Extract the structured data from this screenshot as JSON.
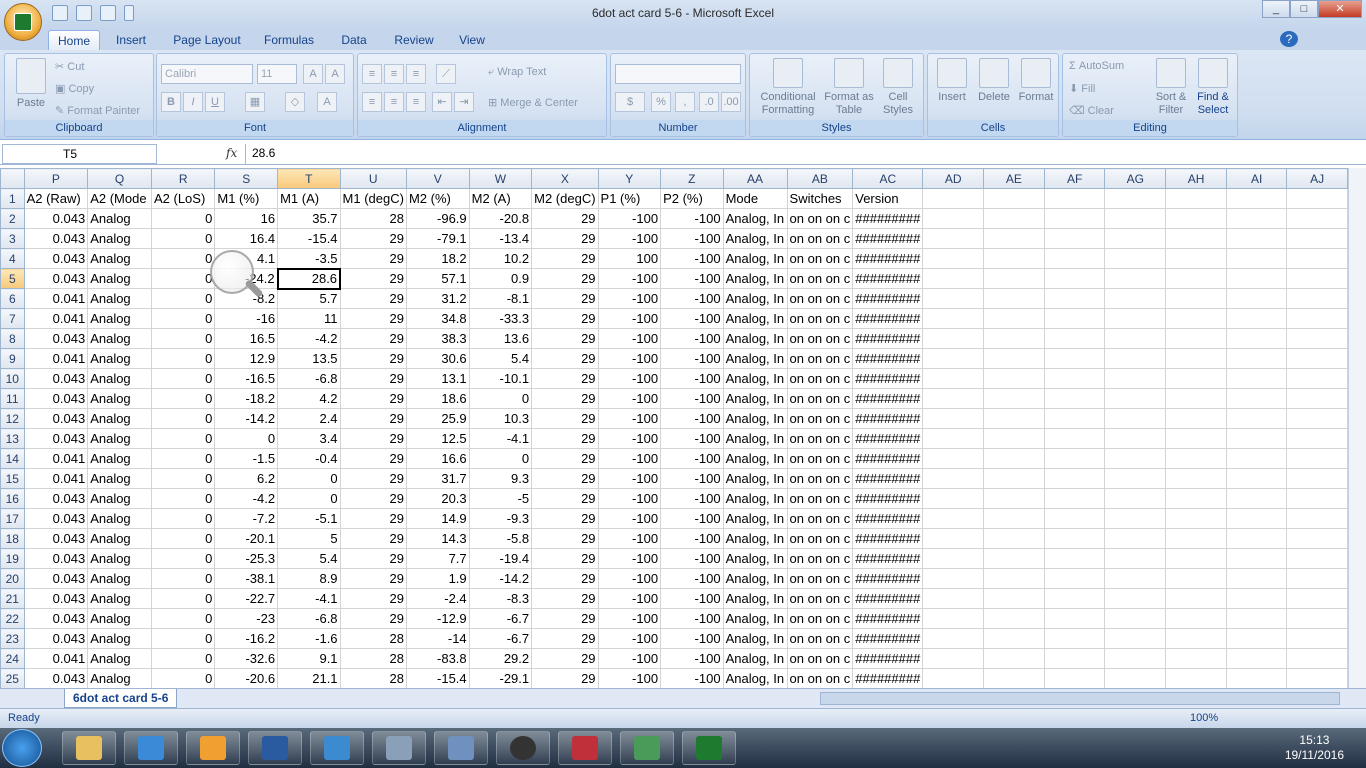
{
  "window": {
    "title": "6dot act card 5-6  -  Microsoft Excel",
    "help": "?"
  },
  "tabs": [
    "Home",
    "Insert",
    "Page Layout",
    "Formulas",
    "Data",
    "Review",
    "View"
  ],
  "ribbon": {
    "clipboard": {
      "label": "Clipboard",
      "paste": "Paste",
      "cut": "Cut",
      "copy": "Copy",
      "format_painter": "Format Painter"
    },
    "font": {
      "label": "Font",
      "name": "Calibri",
      "size": "11"
    },
    "alignment": {
      "label": "Alignment",
      "wrap": "Wrap Text",
      "merge": "Merge & Center"
    },
    "number": {
      "label": "Number"
    },
    "styles": {
      "label": "Styles",
      "cond": "Conditional Formatting",
      "table": "Format as Table",
      "cell": "Cell Styles"
    },
    "cells": {
      "label": "Cells",
      "insert": "Insert",
      "delete": "Delete",
      "format": "Format"
    },
    "editing": {
      "label": "Editing",
      "autosum": "AutoSum",
      "fill": "Fill",
      "clear": "Clear",
      "sort": "Sort & Filter",
      "find": "Find & Select"
    }
  },
  "formula_bar": {
    "name_box": "T5",
    "fx": "fx",
    "content": "28.6"
  },
  "columns": [
    "P",
    "Q",
    "R",
    "S",
    "T",
    "U",
    "V",
    "W",
    "X",
    "Y",
    "Z",
    "AA",
    "AB",
    "AC",
    "AD",
    "AE",
    "AF",
    "AG",
    "AH",
    "AI",
    "AJ"
  ],
  "selected_column": "T",
  "selected_row": 5,
  "header_row": [
    "A2 (Raw)",
    "A2 (Mode",
    "A2 (LoS)",
    "M1 (%)",
    "M1 (A)",
    "M1 (degC)",
    "M2 (%)",
    "M2 (A)",
    "M2 (degC)",
    "P1 (%)",
    "P2 (%)",
    "Mode",
    "Switches",
    "Version"
  ],
  "rows": [
    [
      "0.043",
      "Analog",
      "0",
      "16",
      "35.7",
      "28",
      "-96.9",
      "-20.8",
      "29",
      "-100",
      "-100",
      "Analog, In",
      "on on on c",
      "#########"
    ],
    [
      "0.043",
      "Analog",
      "0",
      "16.4",
      "-15.4",
      "29",
      "-79.1",
      "-13.4",
      "29",
      "-100",
      "-100",
      "Analog, In",
      "on on on c",
      "#########"
    ],
    [
      "0.043",
      "Analog",
      "0",
      "4.1",
      "-3.5",
      "29",
      "18.2",
      "10.2",
      "29",
      "100",
      "-100",
      "Analog, In",
      "on on on c",
      "#########"
    ],
    [
      "0.043",
      "Analog",
      "0",
      "-24.2",
      "28.6",
      "29",
      "57.1",
      "0.9",
      "29",
      "-100",
      "-100",
      "Analog, In",
      "on on on c",
      "#########"
    ],
    [
      "0.041",
      "Analog",
      "0",
      "-8.2",
      "5.7",
      "29",
      "31.2",
      "-8.1",
      "29",
      "-100",
      "-100",
      "Analog, In",
      "on on on c",
      "#########"
    ],
    [
      "0.041",
      "Analog",
      "0",
      "-16",
      "11",
      "29",
      "34.8",
      "-33.3",
      "29",
      "-100",
      "-100",
      "Analog, In",
      "on on on c",
      "#########"
    ],
    [
      "0.043",
      "Analog",
      "0",
      "16.5",
      "-4.2",
      "29",
      "38.3",
      "13.6",
      "29",
      "-100",
      "-100",
      "Analog, In",
      "on on on c",
      "#########"
    ],
    [
      "0.041",
      "Analog",
      "0",
      "12.9",
      "13.5",
      "29",
      "30.6",
      "5.4",
      "29",
      "-100",
      "-100",
      "Analog, In",
      "on on on c",
      "#########"
    ],
    [
      "0.043",
      "Analog",
      "0",
      "-16.5",
      "-6.8",
      "29",
      "13.1",
      "-10.1",
      "29",
      "-100",
      "-100",
      "Analog, In",
      "on on on c",
      "#########"
    ],
    [
      "0.043",
      "Analog",
      "0",
      "-18.2",
      "4.2",
      "29",
      "18.6",
      "0",
      "29",
      "-100",
      "-100",
      "Analog, In",
      "on on on c",
      "#########"
    ],
    [
      "0.043",
      "Analog",
      "0",
      "-14.2",
      "2.4",
      "29",
      "25.9",
      "10.3",
      "29",
      "-100",
      "-100",
      "Analog, In",
      "on on on c",
      "#########"
    ],
    [
      "0.043",
      "Analog",
      "0",
      "0",
      "3.4",
      "29",
      "12.5",
      "-4.1",
      "29",
      "-100",
      "-100",
      "Analog, In",
      "on on on c",
      "#########"
    ],
    [
      "0.041",
      "Analog",
      "0",
      "-1.5",
      "-0.4",
      "29",
      "16.6",
      "0",
      "29",
      "-100",
      "-100",
      "Analog, In",
      "on on on c",
      "#########"
    ],
    [
      "0.041",
      "Analog",
      "0",
      "6.2",
      "0",
      "29",
      "31.7",
      "9.3",
      "29",
      "-100",
      "-100",
      "Analog, In",
      "on on on c",
      "#########"
    ],
    [
      "0.043",
      "Analog",
      "0",
      "-4.2",
      "0",
      "29",
      "20.3",
      "-5",
      "29",
      "-100",
      "-100",
      "Analog, In",
      "on on on c",
      "#########"
    ],
    [
      "0.043",
      "Analog",
      "0",
      "-7.2",
      "-5.1",
      "29",
      "14.9",
      "-9.3",
      "29",
      "-100",
      "-100",
      "Analog, In",
      "on on on c",
      "#########"
    ],
    [
      "0.043",
      "Analog",
      "0",
      "-20.1",
      "5",
      "29",
      "14.3",
      "-5.8",
      "29",
      "-100",
      "-100",
      "Analog, In",
      "on on on c",
      "#########"
    ],
    [
      "0.043",
      "Analog",
      "0",
      "-25.3",
      "5.4",
      "29",
      "7.7",
      "-19.4",
      "29",
      "-100",
      "-100",
      "Analog, In",
      "on on on c",
      "#########"
    ],
    [
      "0.043",
      "Analog",
      "0",
      "-38.1",
      "8.9",
      "29",
      "1.9",
      "-14.2",
      "29",
      "-100",
      "-100",
      "Analog, In",
      "on on on c",
      "#########"
    ],
    [
      "0.043",
      "Analog",
      "0",
      "-22.7",
      "-4.1",
      "29",
      "-2.4",
      "-8.3",
      "29",
      "-100",
      "-100",
      "Analog, In",
      "on on on c",
      "#########"
    ],
    [
      "0.043",
      "Analog",
      "0",
      "-23",
      "-6.8",
      "29",
      "-12.9",
      "-6.7",
      "29",
      "-100",
      "-100",
      "Analog, In",
      "on on on c",
      "#########"
    ],
    [
      "0.043",
      "Analog",
      "0",
      "-16.2",
      "-1.6",
      "28",
      "-14",
      "-6.7",
      "29",
      "-100",
      "-100",
      "Analog, In",
      "on on on c",
      "#########"
    ],
    [
      "0.041",
      "Analog",
      "0",
      "-32.6",
      "9.1",
      "28",
      "-83.8",
      "29.2",
      "29",
      "-100",
      "-100",
      "Analog, In",
      "on on on c",
      "#########"
    ],
    [
      "0.043",
      "Analog",
      "0",
      "-20.6",
      "21.1",
      "28",
      "-15.4",
      "-29.1",
      "29",
      "-100",
      "-100",
      "Analog, In",
      "on on on c",
      "#########"
    ]
  ],
  "sheet_tab": "6dot act card 5-6",
  "status": {
    "ready": "Ready",
    "zoom": "100%"
  },
  "clock": {
    "time": "15:13",
    "date": "19/11/2016"
  }
}
